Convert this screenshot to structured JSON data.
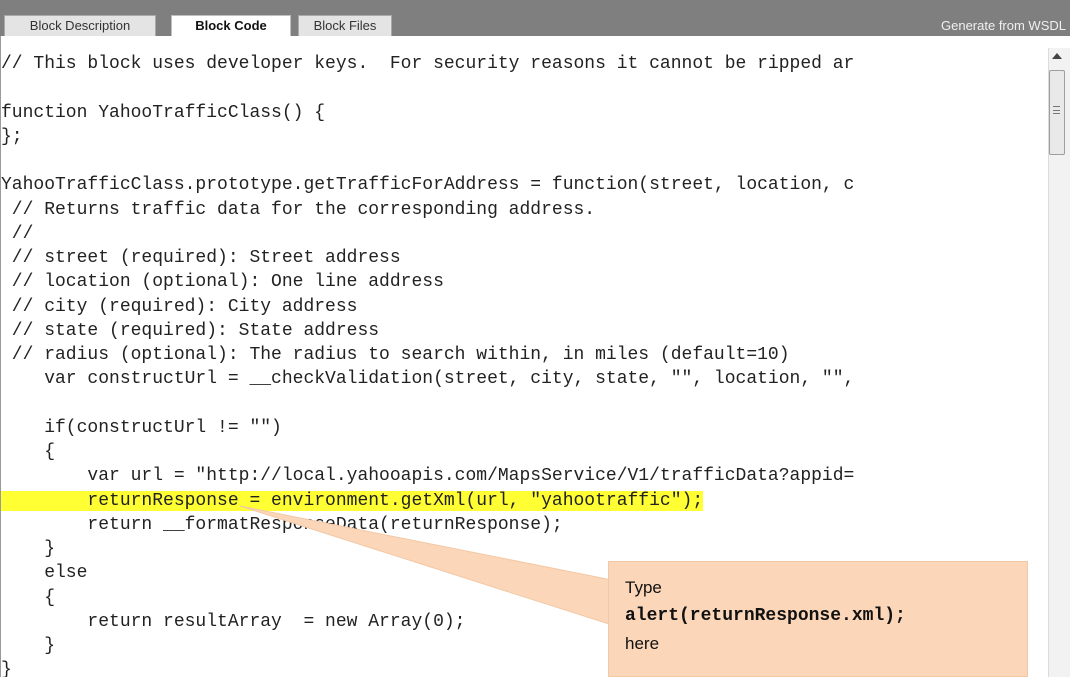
{
  "tabs": [
    {
      "label": "Block Description",
      "active": false
    },
    {
      "label": "Block Code",
      "active": true
    },
    {
      "label": "Block Files",
      "active": false
    }
  ],
  "wsdl_link": "Generate from WSDL",
  "code_lines": [
    "// This block uses developer keys.  For security reasons it cannot be ripped ar",
    "",
    "function YahooTrafficClass() {",
    "};",
    "",
    "YahooTrafficClass.prototype.getTrafficForAddress = function(street, location, c",
    " // Returns traffic data for the corresponding address.",
    " //",
    " // street (required): Street address",
    " // location (optional): One line address",
    " // city (required): City address",
    " // state (required): State address",
    " // radius (optional): The radius to search within, in miles (default=10)",
    "    var constructUrl = __checkValidation(street, city, state, \"\", location, \"\",",
    "",
    "    if(constructUrl != \"\")",
    "    {",
    "        var url = \"http://local.yahooapis.com/MapsService/V1/trafficData?appid=",
    "        returnResponse = environment.getXml(url, \"yahootraffic\");",
    "        return __formatResponseData(returnResponse);",
    "    }",
    "    else",
    "    {",
    "        return resultArray  = new Array(0);",
    "    }",
    "}"
  ],
  "highlighted_line_index": 18,
  "highlight_color": "#ffff33",
  "callout": {
    "line1": "Type",
    "line2": "alert(returnResponse.xml);",
    "line3": "here",
    "color": "#fbd6b8"
  }
}
